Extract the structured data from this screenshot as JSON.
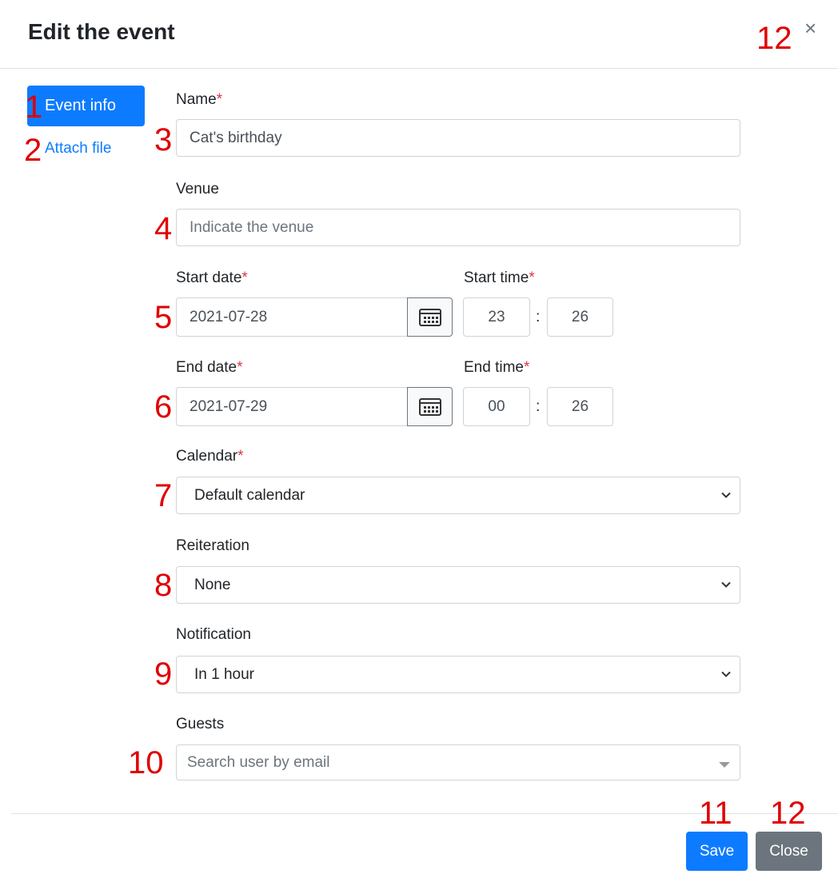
{
  "modal": {
    "title": "Edit the event",
    "close_symbol": "×"
  },
  "nav": {
    "event_info": "Event info",
    "attach_file": "Attach file"
  },
  "form": {
    "name": {
      "label": "Name",
      "required": "*",
      "value": "Cat's birthday"
    },
    "venue": {
      "label": "Venue",
      "placeholder": "Indicate the venue"
    },
    "start_date": {
      "label": "Start date",
      "required": "*",
      "value": "2021-07-28"
    },
    "start_time": {
      "label": "Start time",
      "required": "*",
      "hour": "23",
      "minute": "26"
    },
    "end_date": {
      "label": "End date",
      "required": "*",
      "value": "2021-07-29"
    },
    "end_time": {
      "label": "End time",
      "required": "*",
      "hour": "00",
      "minute": "26"
    },
    "time_separator": ":",
    "calendar": {
      "label": "Calendar",
      "required": "*",
      "value": "Default calendar"
    },
    "reiteration": {
      "label": "Reiteration",
      "value": "None"
    },
    "notification": {
      "label": "Notification",
      "value": "In 1 hour"
    },
    "guests": {
      "label": "Guests",
      "placeholder": "Search user by email"
    }
  },
  "footer": {
    "save": "Save",
    "close": "Close"
  },
  "annotations": [
    "1",
    "2",
    "3",
    "4",
    "5",
    "6",
    "7",
    "8",
    "9",
    "10",
    "11",
    "12",
    "12"
  ],
  "colors": {
    "primary": "#0d7bff",
    "secondary": "#6c757d",
    "required": "#dc3545",
    "annotation": "#e00000"
  }
}
